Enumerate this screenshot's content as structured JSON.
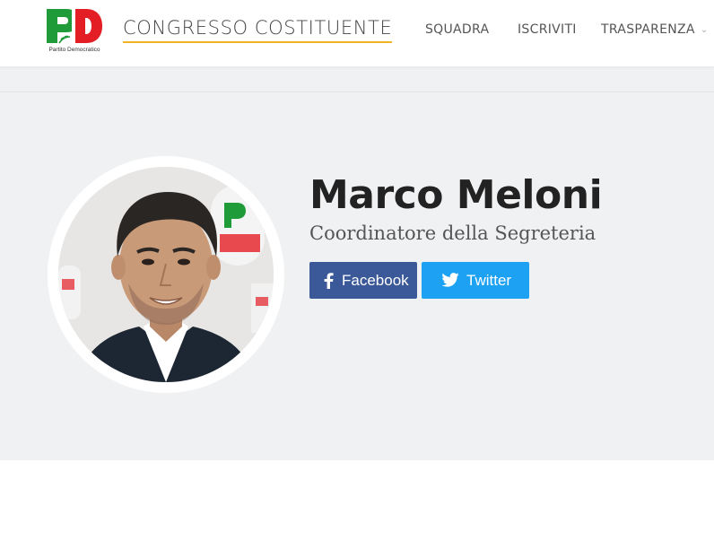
{
  "header": {
    "logo_caption": "Partito Democratico",
    "site_title": "CONGRESSO COSTITUENTE",
    "nav": [
      {
        "label": "SQUADRA"
      },
      {
        "label": "ISCRIVITI"
      },
      {
        "label": "TRASPARENZA",
        "has_dropdown": true
      }
    ]
  },
  "profile": {
    "name": "Marco Meloni",
    "role": "Coordinatore della Segreteria",
    "buttons": {
      "facebook": {
        "label": "Facebook",
        "color": "#3b5998",
        "icon": "facebook-icon"
      },
      "twitter": {
        "label": "Twitter",
        "color": "#1da1f2",
        "icon": "twitter-icon"
      }
    }
  },
  "colors": {
    "band_background": "#f0f1f3",
    "title_underline": "#f0b323",
    "logo_green": "#1f9b3a",
    "logo_red": "#e31e24"
  }
}
